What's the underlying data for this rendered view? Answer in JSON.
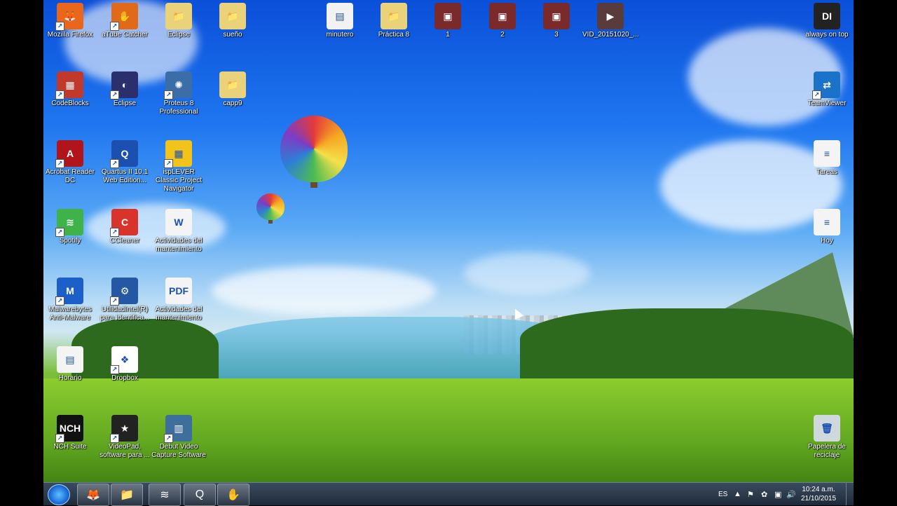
{
  "desktop_icons": [
    {
      "id": "firefox",
      "label": "Mozilla Firefox",
      "icon": "firefox-icon",
      "color": "#e8671c",
      "glyph": "🦊"
    },
    {
      "id": "atube",
      "label": "aTube Catcher",
      "icon": "atube-catcher-icon",
      "color": "#e06a1a",
      "glyph": "✋"
    },
    {
      "id": "eclipse-folder",
      "label": "Eclipse",
      "icon": "folder-icon",
      "color": "#e9d27a",
      "glyph": "📁"
    },
    {
      "id": "sueno",
      "label": "sueño",
      "icon": "folder-icon",
      "color": "#e9d27a",
      "glyph": "📁"
    },
    {
      "id": "minutero",
      "label": "minutero",
      "icon": "document-thumbnail-icon",
      "color": "#f2f2f2",
      "glyph": "▤"
    },
    {
      "id": "practica8",
      "label": "Práctica 8",
      "icon": "folder-icon",
      "color": "#e9d27a",
      "glyph": "📁"
    },
    {
      "id": "img1",
      "label": "1",
      "icon": "image-thumbnail-icon",
      "color": "#7a2a2a",
      "glyph": "▣"
    },
    {
      "id": "img2",
      "label": "2",
      "icon": "image-thumbnail-icon",
      "color": "#7a2a2a",
      "glyph": "▣"
    },
    {
      "id": "img3",
      "label": "3",
      "icon": "image-thumbnail-icon",
      "color": "#7a2a2a",
      "glyph": "▣"
    },
    {
      "id": "vid",
      "label": "VID_20151020_...",
      "icon": "video-thumbnail-icon",
      "color": "#5a3b3b",
      "glyph": "▶"
    },
    {
      "id": "alwaysontop",
      "label": "always on top",
      "icon": "always-on-top-icon",
      "color": "#222222",
      "glyph": "DI"
    },
    {
      "id": "codeblocks",
      "label": "CodeBlocks",
      "icon": "codeblocks-icon",
      "color": "#c0392b",
      "glyph": "▦"
    },
    {
      "id": "eclipse",
      "label": "Eclipse",
      "icon": "eclipse-icon",
      "color": "#2c2f6e",
      "glyph": "◐"
    },
    {
      "id": "proteus",
      "label": "Proteus 8 Professional",
      "icon": "proteus-icon",
      "color": "#3b6ea8",
      "glyph": "✺"
    },
    {
      "id": "capp9",
      "label": "capp9",
      "icon": "folder-icon",
      "color": "#e9d27a",
      "glyph": "📁"
    },
    {
      "id": "teamviewer",
      "label": "TeamViewer",
      "icon": "teamviewer-icon",
      "color": "#1a73c8",
      "glyph": "⇄"
    },
    {
      "id": "acrobat",
      "label": "Acrobat Reader DC",
      "icon": "acrobat-icon",
      "color": "#b1141b",
      "glyph": "A"
    },
    {
      "id": "quartus",
      "label": "Quartus II 10.1 Web Edition...",
      "icon": "quartus-icon",
      "color": "#1b4fb0",
      "glyph": "Q"
    },
    {
      "id": "isplever",
      "label": "ispLEVER Classic Project Navigator",
      "icon": "isplever-icon",
      "color": "#f2c41b",
      "glyph": "▦"
    },
    {
      "id": "tareas",
      "label": "Tareas",
      "icon": "text-file-icon",
      "color": "#f4f4f4",
      "glyph": "≡"
    },
    {
      "id": "spotify",
      "label": "Spotify",
      "icon": "spotify-icon",
      "color": "#3fb24a",
      "glyph": "≋"
    },
    {
      "id": "ccleaner",
      "label": "CCleaner",
      "icon": "ccleaner-icon",
      "color": "#d9342b",
      "glyph": "C"
    },
    {
      "id": "actividades1",
      "label": "Actividades del mantenimiento",
      "icon": "word-document-icon",
      "color": "#f4f4f4",
      "glyph": "W"
    },
    {
      "id": "hoy",
      "label": "Hoy",
      "icon": "text-file-icon",
      "color": "#f4f4f4",
      "glyph": "≡"
    },
    {
      "id": "malwarebytes",
      "label": "Malwarebytes Anti-Malware",
      "icon": "malwarebytes-icon",
      "color": "#1d5fc8",
      "glyph": "M"
    },
    {
      "id": "utilidad",
      "label": "UtilidadIntel(R) para identifica...",
      "icon": "intel-utility-icon",
      "color": "#2457a4",
      "glyph": "⚙"
    },
    {
      "id": "actividades2",
      "label": "Actividades del mantenimiento",
      "icon": "pdf-document-icon",
      "color": "#f4f4f4",
      "glyph": "PDF"
    },
    {
      "id": "horario",
      "label": "Horario",
      "icon": "document-thumbnail-icon",
      "color": "#f4f4f4",
      "glyph": "▤"
    },
    {
      "id": "dropbox",
      "label": "Dropbox",
      "icon": "dropbox-icon",
      "color": "#ffffff",
      "glyph": "❖"
    },
    {
      "id": "nch",
      "label": "NCH Suite",
      "icon": "nch-suite-icon",
      "color": "#111111",
      "glyph": "NCH"
    },
    {
      "id": "videopad",
      "label": "VideoPad, software para ...",
      "icon": "videopad-icon",
      "color": "#222222",
      "glyph": "★"
    },
    {
      "id": "debut",
      "label": "Debut Video Capture Software",
      "icon": "debut-icon",
      "color": "#3e6e9c",
      "glyph": "▥"
    },
    {
      "id": "papelera",
      "label": "Papelera de reciclaje",
      "icon": "recycle-bin-icon",
      "color": "#cfd8dc",
      "glyph": "🗑"
    }
  ],
  "taskbar": {
    "pinned": [
      {
        "id": "tb-firefox",
        "icon": "firefox-icon",
        "glyph": "🦊"
      },
      {
        "id": "tb-explorer",
        "icon": "file-explorer-icon",
        "glyph": "📁"
      },
      {
        "id": "tb-spotify",
        "icon": "spotify-icon",
        "glyph": "≋"
      },
      {
        "id": "tb-quartus",
        "icon": "quartus-icon",
        "glyph": "Q"
      },
      {
        "id": "tb-atube",
        "icon": "atube-catcher-icon",
        "glyph": "✋"
      }
    ],
    "language": "ES",
    "time": "10:24 a.m.",
    "date": "21/10/2015"
  }
}
